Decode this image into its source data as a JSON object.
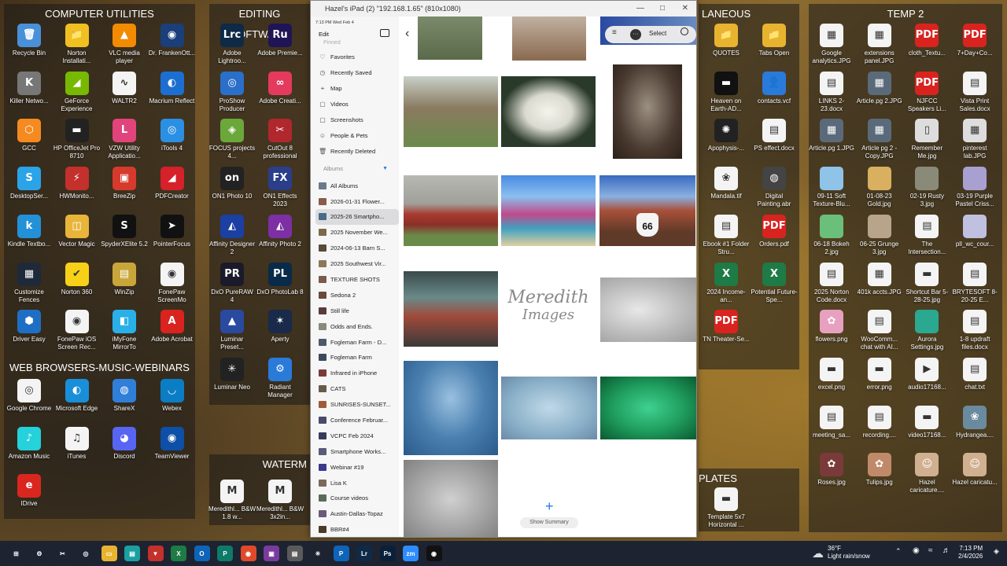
{
  "fences": {
    "computer_utilities": "COMPUTER UTILITIES",
    "editing_software": "EDITING SOFTWARE",
    "web_browsers": "WEB BROWSERS-MUSIC-WEBINARS",
    "watermarks": "WATERM",
    "laneous": "LANEOUS",
    "temp2": "TEMP 2",
    "plates": "PLATES"
  },
  "computer_utilities": [
    {
      "name": "recycle-bin",
      "label": "Recycle Bin",
      "color": "#4a90d9",
      "glyph": "🗑"
    },
    {
      "name": "norton-installation",
      "label": "Norton Installati...",
      "color": "#f0c020",
      "glyph": "📁"
    },
    {
      "name": "vlc",
      "label": "VLC media player",
      "color": "#f28b00",
      "glyph": "▲"
    },
    {
      "name": "frankenotter",
      "label": "Dr. FrankenOtt...",
      "color": "#1a3f7a",
      "glyph": "◉"
    },
    {
      "name": "killer-network",
      "label": "Killer Netwo...",
      "color": "#777",
      "glyph": "K"
    },
    {
      "name": "geforce",
      "label": "GeForce Experience",
      "color": "#76b900",
      "glyph": "◢"
    },
    {
      "name": "waltr2",
      "label": "WALTR2",
      "color": "#f4f4f4",
      "glyph": "∿"
    },
    {
      "name": "macrium",
      "label": "Macrium Reflect",
      "color": "#1c6fd1",
      "glyph": "◐"
    },
    {
      "name": "gcc",
      "label": "GCC",
      "color": "#f58a20",
      "glyph": "⬡"
    },
    {
      "name": "hp-officejet",
      "label": "HP OfficeJet Pro 8710",
      "color": "#222",
      "glyph": "▬"
    },
    {
      "name": "vzw-utility",
      "label": "VZW Utility Applicatio...",
      "color": "#e0447b",
      "glyph": "L"
    },
    {
      "name": "itools",
      "label": "iTools 4",
      "color": "#2b8fe3",
      "glyph": "◎"
    },
    {
      "name": "desktopser",
      "label": "DesktopSer...",
      "color": "#2ba3e8",
      "glyph": "S"
    },
    {
      "name": "hwmonitor",
      "label": "HWMonito...",
      "color": "#c4302b",
      "glyph": "⚡"
    },
    {
      "name": "breezip",
      "label": "BreeZip",
      "color": "#d63a2d",
      "glyph": "▣"
    },
    {
      "name": "pdfcreator",
      "label": "PDFCreator",
      "color": "#d6202a",
      "glyph": "◢"
    },
    {
      "name": "kindle",
      "label": "Kindle Textbo...",
      "color": "#2391d7",
      "glyph": "k"
    },
    {
      "name": "vector-magic",
      "label": "Vector Magic",
      "color": "#e8b43a",
      "glyph": "◫"
    },
    {
      "name": "spyderx",
      "label": "SpyderXElite 5.2",
      "color": "#111",
      "glyph": "S"
    },
    {
      "name": "pointerfocus",
      "label": "PointerFocus",
      "color": "#111",
      "glyph": "➤"
    },
    {
      "name": "customize-fences",
      "label": "Customize Fences",
      "color": "#1e2a3a",
      "glyph": "▦"
    },
    {
      "name": "norton-360",
      "label": "Norton 360",
      "color": "#f7d117",
      "glyph": "✔"
    },
    {
      "name": "winzip",
      "label": "WinZip",
      "color": "#c9a63a",
      "glyph": "▤"
    },
    {
      "name": "fonepaw-screenmo",
      "label": "FonePaw ScreenMo",
      "color": "#f4f4f4",
      "glyph": "◉"
    },
    {
      "name": "driver-easy",
      "label": "Driver Easy",
      "color": "#1e6fc4",
      "glyph": "⬢"
    },
    {
      "name": "fonepaw-ios",
      "label": "FonePaw iOS Screen Rec...",
      "color": "#f4f4f4",
      "glyph": "◉"
    },
    {
      "name": "imyfone",
      "label": "iMyFone MirrorTo",
      "color": "#2ab0e8",
      "glyph": "◧"
    },
    {
      "name": "adobe-acrobat",
      "label": "Adobe Acrobat",
      "color": "#d9231f",
      "glyph": "A"
    }
  ],
  "editing_software": [
    {
      "name": "lightroom",
      "label": "Adobe Lightroo...",
      "color": "#0e2a47",
      "glyph": "Lrc"
    },
    {
      "name": "premiere",
      "label": "Adobe Premie...",
      "color": "#1f1456",
      "glyph": "Ru"
    },
    {
      "name": "proshow",
      "label": "ProShow Producer",
      "color": "#2a6fc9",
      "glyph": "◎"
    },
    {
      "name": "creative-cloud",
      "label": "Adobe Creati...",
      "color": "#e33a5e",
      "glyph": "∞"
    },
    {
      "name": "focus-projects",
      "label": "FOCUS projects 4...",
      "color": "#6aa83a",
      "glyph": "◈"
    },
    {
      "name": "cutout",
      "label": "CutOut 8 professional",
      "color": "#b0272d",
      "glyph": "✂"
    },
    {
      "name": "on1-photo",
      "label": "ON1 Photo 10",
      "color": "#222",
      "glyph": "on"
    },
    {
      "name": "on1-effects",
      "label": "ON1 Effects 2023",
      "color": "#2a3e8a",
      "glyph": "FX"
    },
    {
      "name": "affinity-designer",
      "label": "Affinity Designer 2",
      "color": "#1b3fa3",
      "glyph": "◭"
    },
    {
      "name": "affinity-photo",
      "label": "Affinity Photo 2",
      "color": "#7d2fa3",
      "glyph": "◭"
    },
    {
      "name": "dxo-purerw",
      "label": "DxO PureRAW 4",
      "color": "#1a1a2a",
      "glyph": "PR"
    },
    {
      "name": "dxo-photolab",
      "label": "DxO PhotoLab 8",
      "color": "#0a2a4a",
      "glyph": "PL"
    },
    {
      "name": "luminar-preset",
      "label": "Luminar Preset...",
      "color": "#2a4aa0",
      "glyph": "▲"
    },
    {
      "name": "aperty",
      "label": "Aperty",
      "color": "#1a2a4a",
      "glyph": "✶"
    },
    {
      "name": "luminar-neo",
      "label": "Luminar Neo",
      "color": "#222",
      "glyph": "✳"
    },
    {
      "name": "radiant-manager",
      "label": "Radiant Manager",
      "color": "#2a7ad9",
      "glyph": "⚙"
    }
  ],
  "web_browsers": [
    {
      "name": "google-chrome",
      "label": "Google Chrome",
      "color": "#f4f4f4",
      "glyph": "◎"
    },
    {
      "name": "microsoft-edge",
      "label": "Microsoft Edge",
      "color": "#1a8fd9",
      "glyph": "◐"
    },
    {
      "name": "sharex",
      "label": "ShareX",
      "color": "#2f7fd9",
      "glyph": "◍"
    },
    {
      "name": "webex",
      "label": "Webex",
      "color": "#0b7dc4",
      "glyph": "◡"
    },
    {
      "name": "amazon-music",
      "label": "Amazon Music",
      "color": "#25d1da",
      "glyph": "♪"
    },
    {
      "name": "itunes",
      "label": "iTunes",
      "color": "#f4f4f4",
      "glyph": "♫"
    },
    {
      "name": "discord",
      "label": "Discord",
      "color": "#5865f2",
      "glyph": "◕"
    },
    {
      "name": "teamviewer",
      "label": "TeamViewer",
      "color": "#0e4fa8",
      "glyph": "◉"
    },
    {
      "name": "idrive",
      "label": "IDrive",
      "color": "#d9271f",
      "glyph": "e"
    }
  ],
  "watermarks": [
    {
      "name": "meredith-bw-1",
      "label": "Meredithl... B&W 1.8 w...",
      "color": "#f4f4f4",
      "glyph": "M"
    },
    {
      "name": "meredith-bw-2",
      "label": "Meredithl... B&W 3x2in...",
      "color": "#f4f4f4",
      "glyph": "M"
    }
  ],
  "laneous": [
    {
      "name": "quotes",
      "label": "QUOTES",
      "color": "#e8b430",
      "glyph": "📁"
    },
    {
      "name": "tabs-open",
      "label": "Tabs Open",
      "color": "#e8b430",
      "glyph": "📁"
    },
    {
      "name": "heaven-on-earth",
      "label": "Heaven on Earth-AD...",
      "color": "#111",
      "glyph": "▬"
    },
    {
      "name": "contacts-vcf",
      "label": "contacts.vcf",
      "color": "#2a7ad9",
      "glyph": "👤"
    },
    {
      "name": "apophysis",
      "label": "Apophysis-...",
      "color": "#222",
      "glyph": "✺"
    },
    {
      "name": "ps-effect",
      "label": "PS effect.docx",
      "color": "#f4f4f4",
      "glyph": "▤"
    },
    {
      "name": "mandala-tif",
      "label": "Mandala.tif",
      "color": "#f4f4f4",
      "glyph": "❀"
    },
    {
      "name": "digital-painting",
      "label": "Digital Painting.abr",
      "color": "#444",
      "glyph": "◍"
    },
    {
      "name": "ebook-1",
      "label": "Ebook #1 Folder Stru...",
      "color": "#f4f4f4",
      "glyph": "▤"
    },
    {
      "name": "orders-pdf",
      "label": "Orders.pdf",
      "color": "#d9231f",
      "glyph": "PDF"
    },
    {
      "name": "income-2024",
      "label": "2024 Income-an...",
      "color": "#1e7b45",
      "glyph": "X"
    },
    {
      "name": "potential-future",
      "label": "Potential Future-Spe...",
      "color": "#1e7b45",
      "glyph": "X"
    },
    {
      "name": "tn-theater",
      "label": "TN Theater-Se...",
      "color": "#d9231f",
      "glyph": "PDF"
    }
  ],
  "plates": [
    {
      "name": "template-5x7",
      "label": "Template 5x7 Horizontal ...",
      "color": "#f4f4f4",
      "glyph": "▬"
    }
  ],
  "temp2": [
    {
      "name": "google-analytics",
      "label": "Google analytics.JPG",
      "color": "#f4f4f4",
      "glyph": "▦"
    },
    {
      "name": "extensions-panel",
      "label": "extensions panel.JPG",
      "color": "#f4f4f4",
      "glyph": "▦"
    },
    {
      "name": "cloth-texture",
      "label": "cloth_Textu...",
      "color": "#d9231f",
      "glyph": "PDF"
    },
    {
      "name": "7-day-code",
      "label": "7+Day+Co...",
      "color": "#d9231f",
      "glyph": "PDF"
    },
    {
      "name": "links-docx",
      "label": "LINKS 2-23.docx",
      "color": "#f4f4f4",
      "glyph": "▤"
    },
    {
      "name": "article-pg-2",
      "label": "Article.pg 2.JPG",
      "color": "#5a6a7a",
      "glyph": "▦"
    },
    {
      "name": "njfcc-speakers",
      "label": "NJFCC Speakers Li...",
      "color": "#d9231f",
      "glyph": "PDF"
    },
    {
      "name": "vista-print",
      "label": "Vista Print Sales.docx",
      "color": "#f4f4f4",
      "glyph": "▤"
    },
    {
      "name": "article-pg-1",
      "label": "Article.pg 1.JPG",
      "color": "#5a6a7a",
      "glyph": "▦"
    },
    {
      "name": "article-pg-2-copy",
      "label": "Article pg 2 - Copy.JPG",
      "color": "#5a6a7a",
      "glyph": "▦"
    },
    {
      "name": "remember-me",
      "label": "Remember Me.jpg",
      "color": "#ddd",
      "glyph": "▯"
    },
    {
      "name": "pinterest-lab",
      "label": "pinterest lab.JPG",
      "color": "#ddd",
      "glyph": "▦"
    },
    {
      "name": "soft-texture",
      "label": "09-11 Soft Texture-Blu...",
      "color": "#8fc3e8",
      "glyph": " "
    },
    {
      "name": "gold-jpg",
      "label": "01-08-23 Gold.jpg",
      "color": "#d9b060",
      "glyph": " "
    },
    {
      "name": "rusty-3",
      "label": "02-19 Rusty 3.jpg",
      "color": "#8a8a78",
      "glyph": " "
    },
    {
      "name": "purple-pastel",
      "label": "03-19 Purple Pastel Criss...",
      "color": "#a8a0d0",
      "glyph": " "
    },
    {
      "name": "bokeh-2",
      "label": "06-18 Bokeh 2.jpg",
      "color": "#6ac07a",
      "glyph": " "
    },
    {
      "name": "grunge-3",
      "label": "06-25 Grunge 3.jpg",
      "color": "#b8a48a",
      "glyph": " "
    },
    {
      "name": "the-intersection",
      "label": "The Intersection...",
      "color": "#f4f4f4",
      "glyph": "▤"
    },
    {
      "name": "pll-wc-cour",
      "label": "pll_wc_cour...",
      "color": "#c0c0e0",
      "glyph": " "
    },
    {
      "name": "norton-code",
      "label": "2025 Norton Code.docx",
      "color": "#f4f4f4",
      "glyph": "▤"
    },
    {
      "name": "401k-accts",
      "label": "401k accts.JPG",
      "color": "#f4f4f4",
      "glyph": "▦"
    },
    {
      "name": "shortcut-bar",
      "label": "Shortcut Bar 5-28-25.jpg",
      "color": "#f4f4f4",
      "glyph": "▬"
    },
    {
      "name": "brytesoft",
      "label": "BRYTESOFT 8-20-25 E...",
      "color": "#f4f4f4",
      "glyph": "▤"
    },
    {
      "name": "flowers-png",
      "label": "flowers.png",
      "color": "#e8a0c0",
      "glyph": "✿"
    },
    {
      "name": "woocommerce",
      "label": "WooComm... chat with AI...",
      "color": "#f4f4f4",
      "glyph": "▤"
    },
    {
      "name": "aurora-settings",
      "label": "Aurora Settings.jpg",
      "color": "#2aa890",
      "glyph": " "
    },
    {
      "name": "updraft-files",
      "label": "1-8 updraft files.docx",
      "color": "#f4f4f4",
      "glyph": "▤"
    },
    {
      "name": "excel-png",
      "label": "excel.png",
      "color": "#f4f4f4",
      "glyph": "▬"
    },
    {
      "name": "error-png",
      "label": "error.png",
      "color": "#f4f4f4",
      "glyph": "▬"
    },
    {
      "name": "audio-file",
      "label": "audio17168...",
      "color": "#f4f4f4",
      "glyph": "▶"
    },
    {
      "name": "chat-txt",
      "label": "chat.txt",
      "color": "#f4f4f4",
      "glyph": "▤"
    },
    {
      "name": "meeting-sa",
      "label": "meeting_sa...",
      "color": "#f4f4f4",
      "glyph": "▤"
    },
    {
      "name": "recording",
      "label": "recording....",
      "color": "#f4f4f4",
      "glyph": "▤"
    },
    {
      "name": "video-file",
      "label": "video17168...",
      "color": "#f4f4f4",
      "glyph": "▬"
    },
    {
      "name": "hydrangea",
      "label": "Hydrangea....",
      "color": "#6a8aa0",
      "glyph": "❀"
    },
    {
      "name": "roses-jpg",
      "label": "Roses.jpg",
      "color": "#7a3a3a",
      "glyph": "✿"
    },
    {
      "name": "tulips-jpg",
      "label": "Tulips.jpg",
      "color": "#c08a6a",
      "glyph": "✿"
    },
    {
      "name": "hazel-caricature-1",
      "label": "Hazel caricature....",
      "color": "#d0b090",
      "glyph": "☺"
    },
    {
      "name": "hazel-caricature-2",
      "label": "Hazel caricatu...",
      "color": "#d0b090",
      "glyph": "☺"
    }
  ],
  "ipad": {
    "window_title": "Hazel's iPad (2) \"192.168.1.65\" (810x1080)",
    "status_time": "7:13 PM  Wed Feb 4",
    "edit": "Edit",
    "pinned": "Pinned",
    "albums_header": "Albums",
    "select": "Select",
    "show_summary": "Show Summary",
    "watermark_line1": "Meredith",
    "watermark_line2": "Images",
    "pinned_items": [
      {
        "label": "Favorites",
        "icon": "♡"
      },
      {
        "label": "Recently Saved",
        "icon": "◷"
      },
      {
        "label": "Map",
        "icon": "⌖"
      },
      {
        "label": "Videos",
        "icon": "▢"
      },
      {
        "label": "Screenshots",
        "icon": "▢"
      },
      {
        "label": "People & Pets",
        "icon": "☺"
      },
      {
        "label": "Recently Deleted",
        "icon": "🗑"
      }
    ],
    "albums": [
      "All Albums",
      "2026-01-31 Flower...",
      "2025-26 Smartpho...",
      "2025 November We...",
      "2024-06-13 Barn S...",
      "2025 Southwest Vir...",
      "TEXTURE SHOTS",
      "Sedona 2",
      "Still life",
      "Odds and Ends.",
      "Fogleman Farm - D...",
      "Fogleman Farm",
      "Infrared in iPhone",
      "CATS",
      "SUNRISES-SUNSET...",
      "Conference Februar...",
      "VCPC Feb 2024",
      "Smartphone Works...",
      "Webinar #19",
      "Lisa K",
      "Course videos",
      "Austin-Dallas-Topaz",
      "BBR#4"
    ]
  },
  "taskbar": {
    "weather_temp": "36°F",
    "weather_desc": "Light rain/snow",
    "time": "7:13 PM",
    "date": "2/4/2026",
    "apps": [
      {
        "name": "start-button",
        "color": "#1d2330",
        "glyph": "⊞"
      },
      {
        "name": "settings-icon",
        "color": "#1d2330",
        "glyph": "⚙"
      },
      {
        "name": "snipping-icon",
        "color": "#1d2330",
        "glyph": "✂"
      },
      {
        "name": "chrome-taskbar-icon",
        "color": "#1d2330",
        "glyph": "◎"
      },
      {
        "name": "file-explorer-icon",
        "color": "#e8b430",
        "glyph": "▭"
      },
      {
        "name": "app-teal-icon",
        "color": "#1aa0a0",
        "glyph": "▤"
      },
      {
        "name": "shield-taskbar-icon",
        "color": "#c4302b",
        "glyph": "▼"
      },
      {
        "name": "excel-taskbar-icon",
        "color": "#1e7b45",
        "glyph": "X"
      },
      {
        "name": "outlook-taskbar-icon",
        "color": "#0e64b8",
        "glyph": "O"
      },
      {
        "name": "publisher-taskbar-icon",
        "color": "#0e7a6a",
        "glyph": "P"
      },
      {
        "name": "app-red-icon",
        "color": "#e04a2a",
        "glyph": "◉"
      },
      {
        "name": "app-purple-icon",
        "color": "#7a3aa0",
        "glyph": "▣"
      },
      {
        "name": "app-gray-icon",
        "color": "#5a5a5a",
        "glyph": "▤"
      },
      {
        "name": "luminar-taskbar-icon",
        "color": "#1d2330",
        "glyph": "✳"
      },
      {
        "name": "publisher2-taskbar-icon",
        "color": "#0e64b8",
        "glyph": "P"
      },
      {
        "name": "lightroom-taskbar-icon",
        "color": "#0e2a47",
        "glyph": "Lr"
      },
      {
        "name": "photoshop-taskbar-icon",
        "color": "#0a1f3a",
        "glyph": "Ps"
      },
      {
        "name": "zoom-taskbar-icon",
        "color": "#2d8cff",
        "glyph": "zm"
      },
      {
        "name": "mirror-taskbar-icon",
        "color": "#111",
        "glyph": "◉"
      }
    ]
  }
}
